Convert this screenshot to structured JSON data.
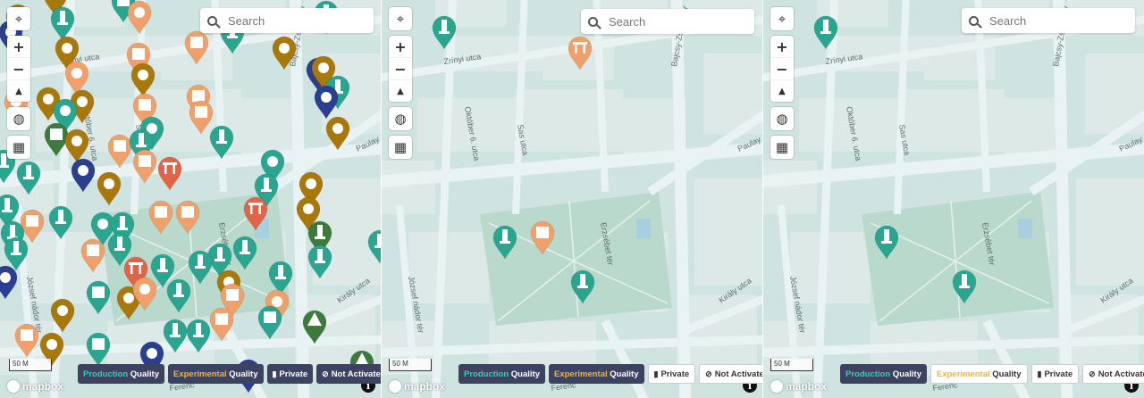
{
  "search": {
    "placeholder": "Search"
  },
  "controls": {
    "locate_icon": "crosshair-icon",
    "zoom_in": "+",
    "zoom_out": "−",
    "compass": "▲",
    "globe_icon": "globe-icon",
    "grid_icon": "grid-icon"
  },
  "scale_label": "50 M",
  "attribution": {
    "mapbox": "mapbox",
    "info": "i"
  },
  "legend": {
    "production_word": "Production",
    "experimental_word": "Experimental",
    "quality_word": "Quality",
    "private": "Private",
    "not_activated": "Not Activated"
  },
  "streets": {
    "zrinyi": "Zrínyi utca",
    "oktober": "Október 6. utca",
    "sas": "Sas utca",
    "bajcsy": "Bajcsy-Zsilinszky",
    "paulay": "Paulay",
    "erzsebet": "Erzsébet tér",
    "jozsef_nador": "József nádor tér",
    "kiraly": "Király utca",
    "ferenc": "Ferenc"
  },
  "colors": {
    "map_bg": "#cfe3e0",
    "block": "#dde9e7",
    "park": "#b9d9cc",
    "road": "#eaf3f3",
    "teal": "#2aa58f",
    "orange": "#f0a06a",
    "gold": "#a8790a",
    "navy": "#2a3f8f",
    "green": "#3c7b3c",
    "red": "#e06448",
    "legend_dark": "#3d4260"
  }
}
